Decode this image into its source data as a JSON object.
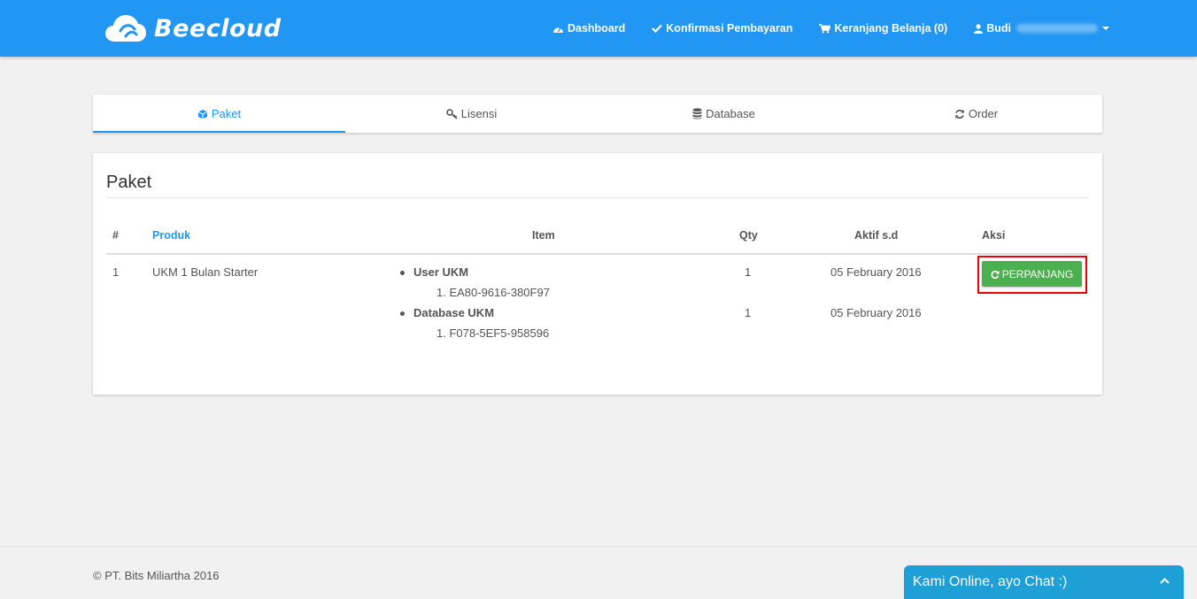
{
  "app": {
    "brand": "Beecloud",
    "accent_color": "#2196f3"
  },
  "nav": {
    "dashboard": "Dashboard",
    "konfirmasi": "Konfirmasi Pembayaran",
    "keranjang": "Keranjang Belanja (0)",
    "user": "Budi"
  },
  "tabs": [
    {
      "label": "Paket",
      "icon": "cube-icon",
      "active": true
    },
    {
      "label": "Lisensi",
      "icon": "key-icon",
      "active": false
    },
    {
      "label": "Database",
      "icon": "database-icon",
      "active": false
    },
    {
      "label": "Order",
      "icon": "refresh-icon",
      "active": false
    }
  ],
  "panel": {
    "title": "Paket",
    "headers": {
      "num": "#",
      "produk": "Produk",
      "item": "Item",
      "qty": "Qty",
      "aktif": "Aktif s.d",
      "aksi": "Aksi"
    },
    "row": {
      "num": "1",
      "produk": "UKM 1 Bulan Starter",
      "items": [
        {
          "title": "User UKM",
          "license": "1. EA80-9616-380F97",
          "qty": "1",
          "aktif": "05 February 2016"
        },
        {
          "title": "Database UKM",
          "license": "1. F078-5EF5-958596",
          "qty": "1",
          "aktif": "05 February 2016"
        }
      ],
      "action_label": "PERPANJANG",
      "action_color": "#4caf50"
    }
  },
  "footer": {
    "copyright": "© PT. Bits Miliartha 2016"
  },
  "chat": {
    "label": "Kami Online, ayo Chat :)",
    "color": "#1e9fd6"
  }
}
